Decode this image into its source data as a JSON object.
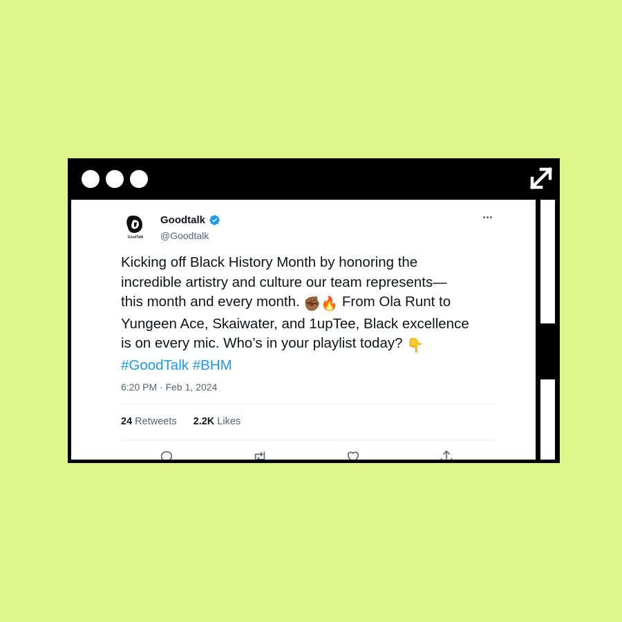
{
  "colors": {
    "page_background": "#dff68b",
    "window_frame": "#000000",
    "link_blue": "#1d9bf0",
    "verified_blue": "#1d9bf0",
    "secondary_text": "#536471"
  },
  "window": {
    "controls": [
      "dot-icon",
      "dot-icon",
      "dot-icon"
    ],
    "expand_icon": "expand-arrows-icon"
  },
  "tweet": {
    "author": {
      "name": "Goodtalk",
      "handle": "@Goodtalk",
      "avatar_text": "GoodTalk",
      "verified": true
    },
    "text": {
      "line1": "Kicking off Black History Month by honoring the",
      "line2": "incredible artistry and culture our team represents—",
      "line3_start": "this month and every month.",
      "emoji_fist": "✊🏾",
      "emoji_fire": "🔥",
      "line3_end": "From Ola Runt to",
      "line4": "Yungeen Ace, Skaiwater, and 1upTee, Black excellence",
      "line5": "is on every mic. Who’s in your playlist today?",
      "emoji_point": "👇",
      "hashtag1": "#GoodTalk",
      "hashtag2": "#BHM"
    },
    "timestamp": "6:20 PM · Feb 1, 2024",
    "stats": {
      "retweets_count": "24",
      "retweets_label": "Retweets",
      "likes_count": "2.2K",
      "likes_label": "Likes"
    },
    "actions": [
      "reply-icon",
      "retweet-icon",
      "like-icon",
      "share-icon"
    ]
  }
}
